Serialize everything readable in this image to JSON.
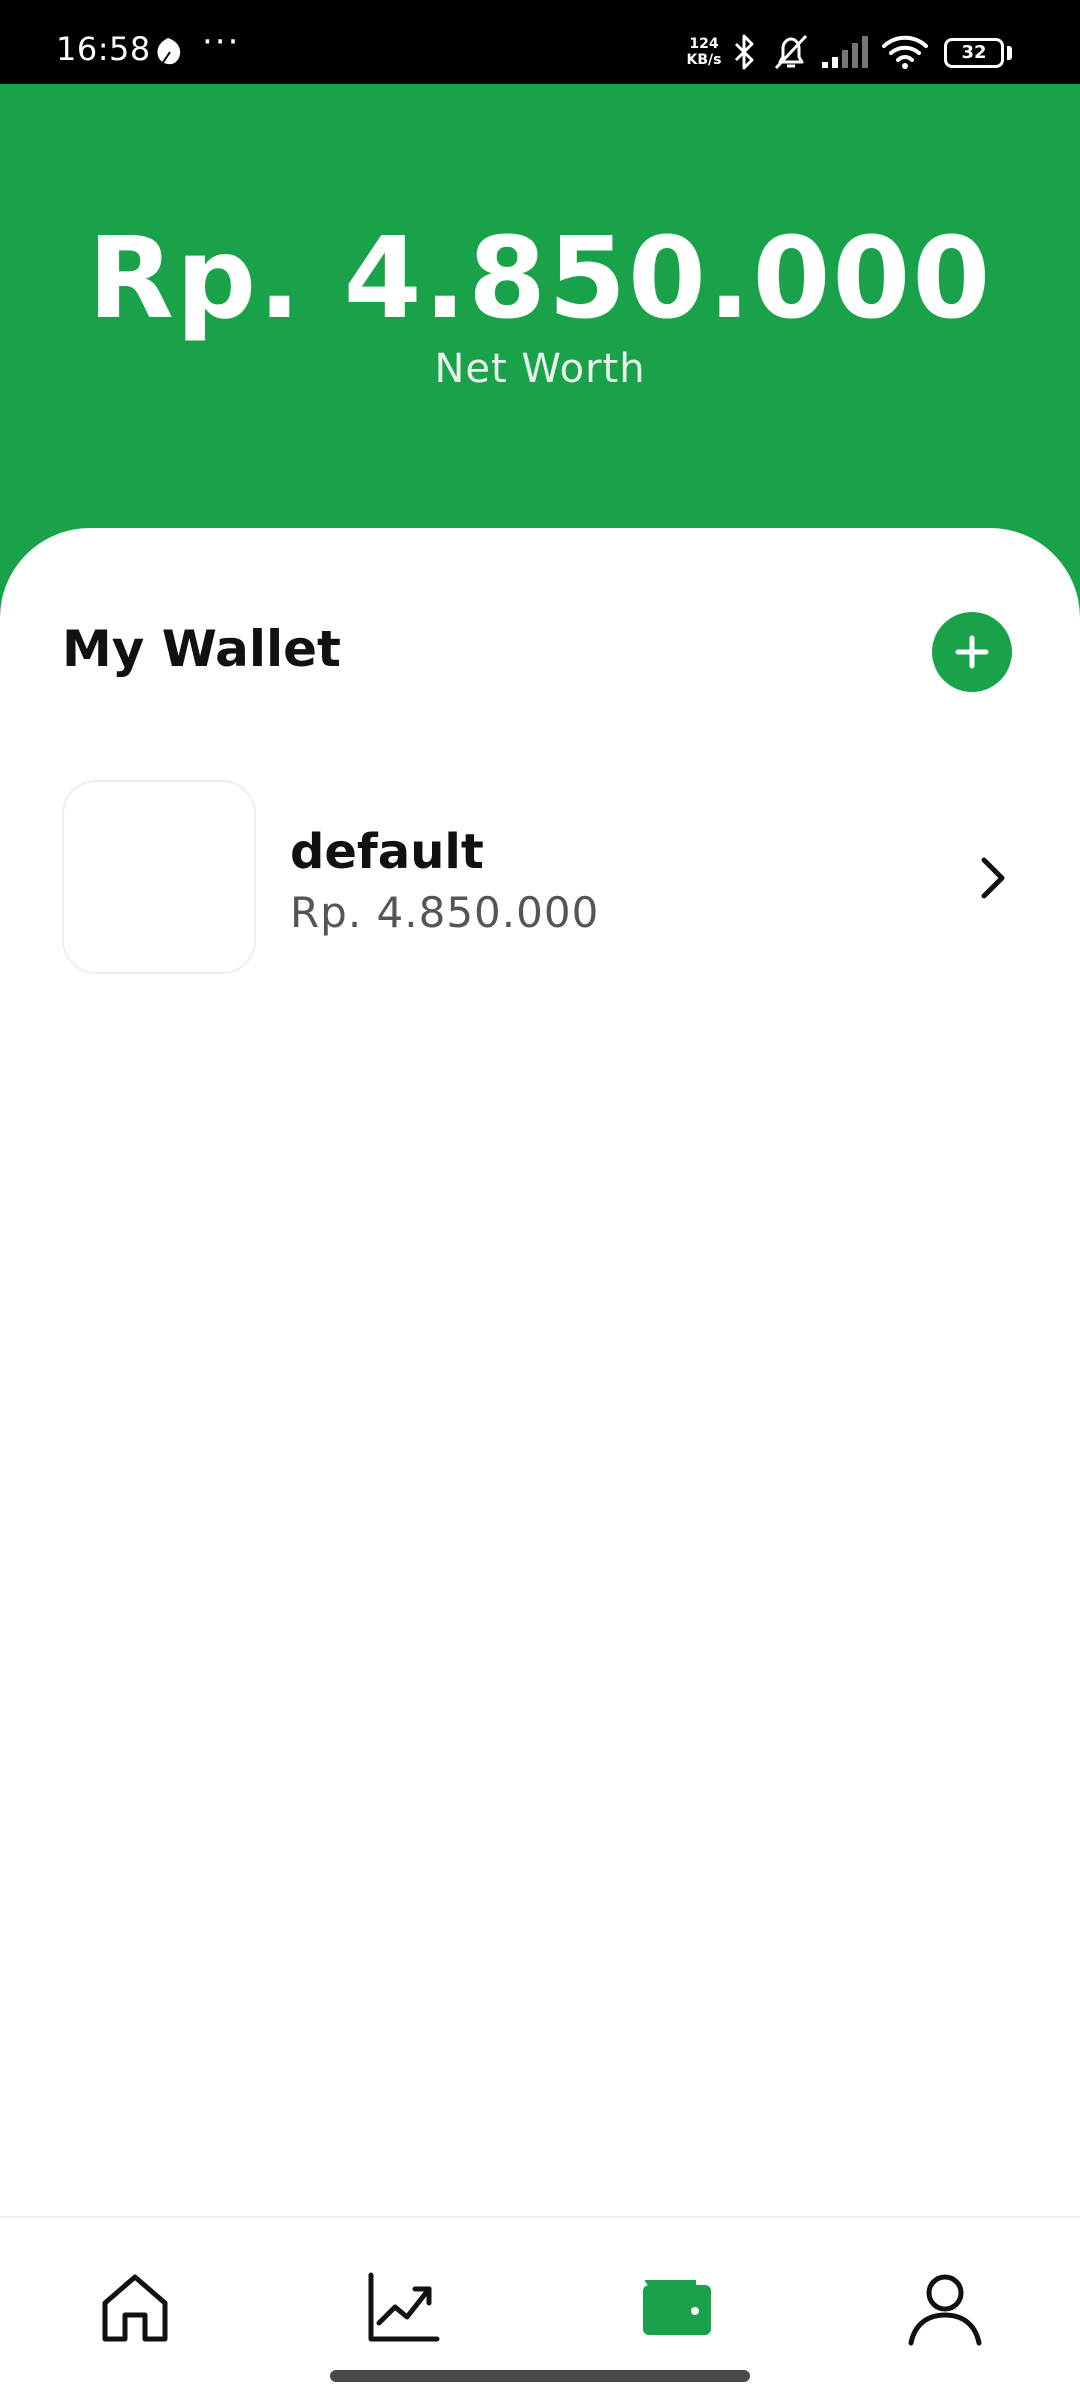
{
  "status_bar": {
    "time": "16:58",
    "more": "···",
    "net_speed_value": "124",
    "net_speed_unit": "KB/s",
    "battery": "32"
  },
  "header": {
    "net_worth_value": "Rp. 4.850.000",
    "net_worth_label": "Net Worth"
  },
  "wallet_section": {
    "title": "My Wallet",
    "wallets": [
      {
        "name": "default",
        "balance": "Rp. 4.850.000"
      }
    ]
  },
  "bottom_nav": {
    "items": [
      {
        "icon": "home-icon"
      },
      {
        "icon": "chart-icon"
      },
      {
        "icon": "wallet-icon",
        "active": true
      },
      {
        "icon": "profile-icon"
      }
    ],
    "active_color": "#1aa24b"
  },
  "colors": {
    "brand": "#1aa24b"
  }
}
